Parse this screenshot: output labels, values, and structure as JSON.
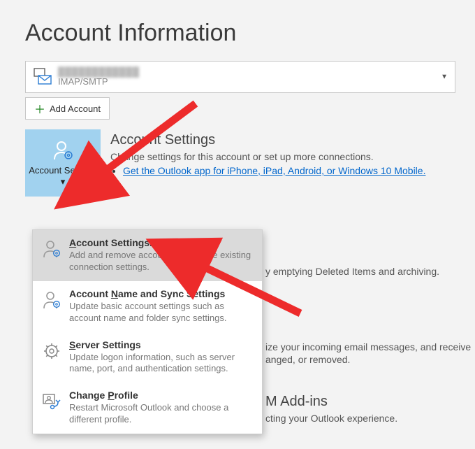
{
  "page_title": "Account Information",
  "account": {
    "email": "████████████",
    "protocol": "IMAP/SMTP"
  },
  "add_account_label": "Add Account",
  "settings_tile": {
    "label": "Account Settings",
    "dropdown_indicator": "▾"
  },
  "settings_info": {
    "heading": "Account Settings",
    "description": "Change settings for this account or set up more connections.",
    "link_text": "Get the Outlook app for iPhone, iPad, Android, or Windows 10 Mobile."
  },
  "behind": {
    "mailbox_desc": "y emptying Deleted Items and archiving.",
    "rules_line1": "ize your incoming email messages, and receive",
    "rules_line2": "anged, or removed.",
    "addins_heading": "M Add-ins",
    "addins_desc": "cting your Outlook experience."
  },
  "menu": {
    "items": [
      {
        "title_html": "<span class='underline-letter'>A</span>ccount Settings...",
        "desc": "Add and remove accounts or change existing connection settings."
      },
      {
        "title_html": "Account <span class='underline-letter'>N</span>ame and Sync Settings",
        "desc": "Update basic account settings such as account name and folder sync settings."
      },
      {
        "title_html": "<span class='underline-letter'>S</span>erver Settings",
        "desc": "Update logon information, such as server name, port, and authentication settings."
      },
      {
        "title_html": "Change <span class='underline-letter'>P</span>rofile",
        "desc": "Restart Microsoft Outlook and choose a different profile."
      }
    ]
  }
}
